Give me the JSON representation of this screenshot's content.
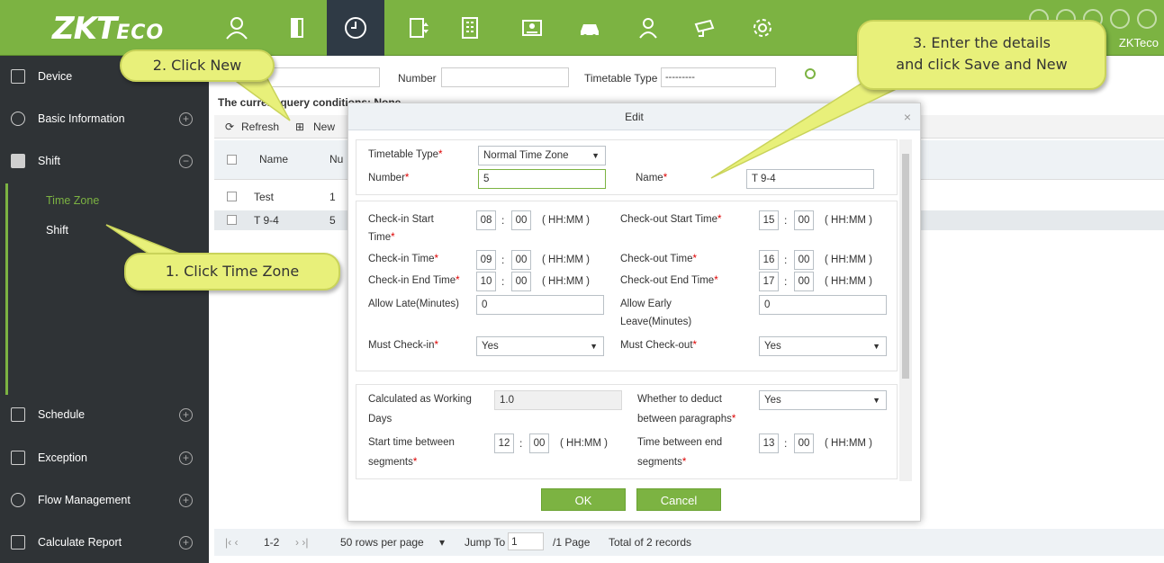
{
  "brand": {
    "logo_main": "ZKT",
    "logo_sub": "ECO",
    "user": "ZKTeco"
  },
  "top_icons": [
    "person-icon",
    "door-icon",
    "clock-icon",
    "elevator-icon",
    "building-icon",
    "badge-icon",
    "car-icon",
    "guard-icon",
    "camera-icon",
    "gear-icon"
  ],
  "sidebar": {
    "items": [
      {
        "label": "Device",
        "icon": "device-icon"
      },
      {
        "label": "Basic Information",
        "icon": "basic-info-icon",
        "toggle": "+"
      },
      {
        "label": "Shift",
        "icon": "shift-icon",
        "toggle": "−"
      },
      {
        "label": "Schedule",
        "icon": "schedule-icon",
        "toggle": "+"
      },
      {
        "label": "Exception",
        "icon": "exception-icon",
        "toggle": "+"
      },
      {
        "label": "Flow Management",
        "icon": "flow-icon",
        "toggle": "+"
      },
      {
        "label": "Calculate Report",
        "icon": "report-icon",
        "toggle": "+"
      }
    ],
    "sub_items": [
      {
        "label": "Time Zone"
      },
      {
        "label": "Shift"
      }
    ]
  },
  "search": {
    "number_label": "Number",
    "type_label": "Timetable Type",
    "type_value": "---------"
  },
  "condition_text": "The current query conditions: None",
  "toolbar": {
    "refresh": "Refresh",
    "new": "New"
  },
  "grid": {
    "headers": [
      "Name",
      "Nu"
    ],
    "rows": [
      {
        "name": "Test",
        "num": "1"
      },
      {
        "name": "T 9-4",
        "num": "5"
      }
    ]
  },
  "pager": {
    "range": "1-2",
    "rows_per_page": "50 rows per page",
    "jump_label": "Jump To",
    "jump_value": "1",
    "pages": "/1 Page",
    "total": "Total of 2 records"
  },
  "dialog": {
    "title": "Edit",
    "timetable_type_label": "Timetable Type",
    "timetable_type_value": "Normal Time Zone",
    "number_label": "Number",
    "number_value": "5",
    "name_label": "Name",
    "name_value": "T 9-4",
    "checkin_start_label": "Check-in Start",
    "checkin_start_label2": "Time",
    "checkin_start_h": "08",
    "checkin_start_m": "00",
    "checkout_start_label": "Check-out Start Time",
    "checkout_start_h": "15",
    "checkout_start_m": "00",
    "checkin_time_label": "Check-in Time",
    "checkin_time_h": "09",
    "checkin_time_m": "00",
    "checkout_time_label": "Check-out Time",
    "checkout_time_h": "16",
    "checkout_time_m": "00",
    "checkin_end_label": "Check-in End Time",
    "checkin_end_h": "10",
    "checkin_end_m": "00",
    "checkout_end_label": "Check-out End Time",
    "checkout_end_h": "17",
    "checkout_end_m": "00",
    "hhmm": "( HH:MM )",
    "allow_late_label": "Allow Late(Minutes)",
    "allow_late_value": "0",
    "allow_early_label": "Allow Early",
    "allow_early_label2": "Leave(Minutes)",
    "allow_early_value": "0",
    "must_checkin_label": "Must Check-in",
    "must_checkin_value": "Yes",
    "must_checkout_label": "Must Check-out",
    "must_checkout_value": "Yes",
    "calc_days_label": "Calculated as Working",
    "calc_days_label2": "Days",
    "calc_days_value": "1.0",
    "deduct_label": "Whether to deduct",
    "deduct_label2": "between paragraphs",
    "deduct_value": "Yes",
    "seg_start_label": "Start time between",
    "seg_start_label2": "segments",
    "seg_start_h": "12",
    "seg_start_m": "00",
    "seg_end_label": "Time between end",
    "seg_end_label2": "segments",
    "seg_end_h": "13",
    "seg_end_m": "00",
    "ok": "OK",
    "cancel": "Cancel"
  },
  "callouts": {
    "step1": "1. Click Time Zone",
    "step2": "2. Click New",
    "step3_line1": "3. Enter the details",
    "step3_line2": "and click Save and New"
  },
  "colors": {
    "accent": "#7cb342",
    "sidebar": "#2f3336",
    "callout": "#e8f07a"
  }
}
